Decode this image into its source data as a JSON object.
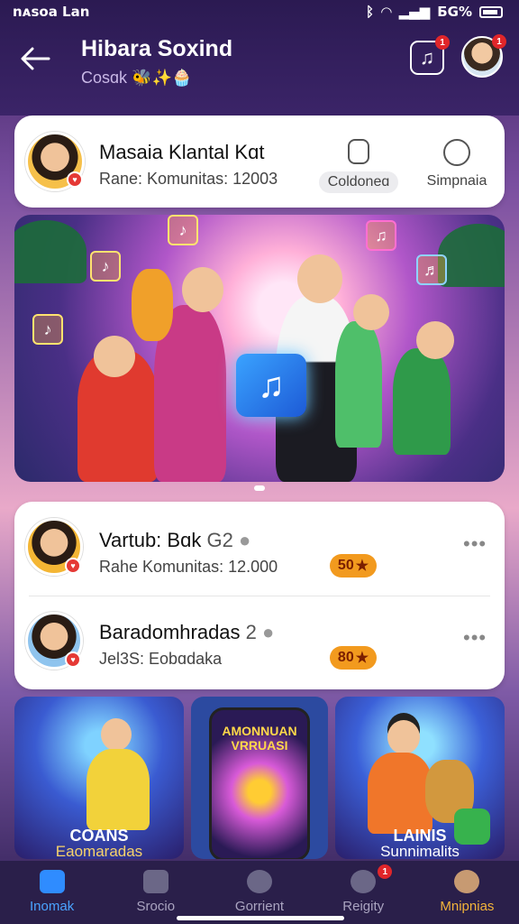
{
  "status": {
    "left": "nᴀsoa Lan",
    "right": "ƂG%"
  },
  "header": {
    "title": "Hibara Soxind",
    "subtitle": "Cosɑk",
    "subtitle_emoji": "🐝✨🧁",
    "music_badge": "1",
    "avatar_badge": "1"
  },
  "profile_card": {
    "name": "Masaia Klantal Kɑt",
    "meta": "Rane: Komunitas: 12003",
    "action1_label": "Coldoneɑ",
    "action2_label": "Simpnaia"
  },
  "list": [
    {
      "name": "Vartub: Bɑk",
      "suffix": "G2",
      "meta": "Rahe Komunitas: 12.000",
      "coin": "50"
    },
    {
      "name": "Baradomhradas",
      "suffix": "2",
      "meta": "Jel3S: Eobɑdaka",
      "coin": "80"
    }
  ],
  "tiles": [
    {
      "title": "COANS",
      "sub": "Eaomaradas"
    },
    {
      "title": "AMONNUAN VRRUASI",
      "sub": ""
    },
    {
      "title": "LAINIS",
      "sub": "Sunnimalits"
    }
  ],
  "nav": [
    {
      "label": "Inomak",
      "active": true
    },
    {
      "label": "Srocio",
      "active": false
    },
    {
      "label": "Gorrient",
      "active": false
    },
    {
      "label": "Reigity",
      "active": false,
      "badge": "1"
    },
    {
      "label": "Mnipnias",
      "active": false
    }
  ],
  "colors": {
    "accent": "#2f8cff",
    "coin": "#f29a1e",
    "badge": "#e0262a",
    "nav_active_label": "#f2b33a"
  }
}
